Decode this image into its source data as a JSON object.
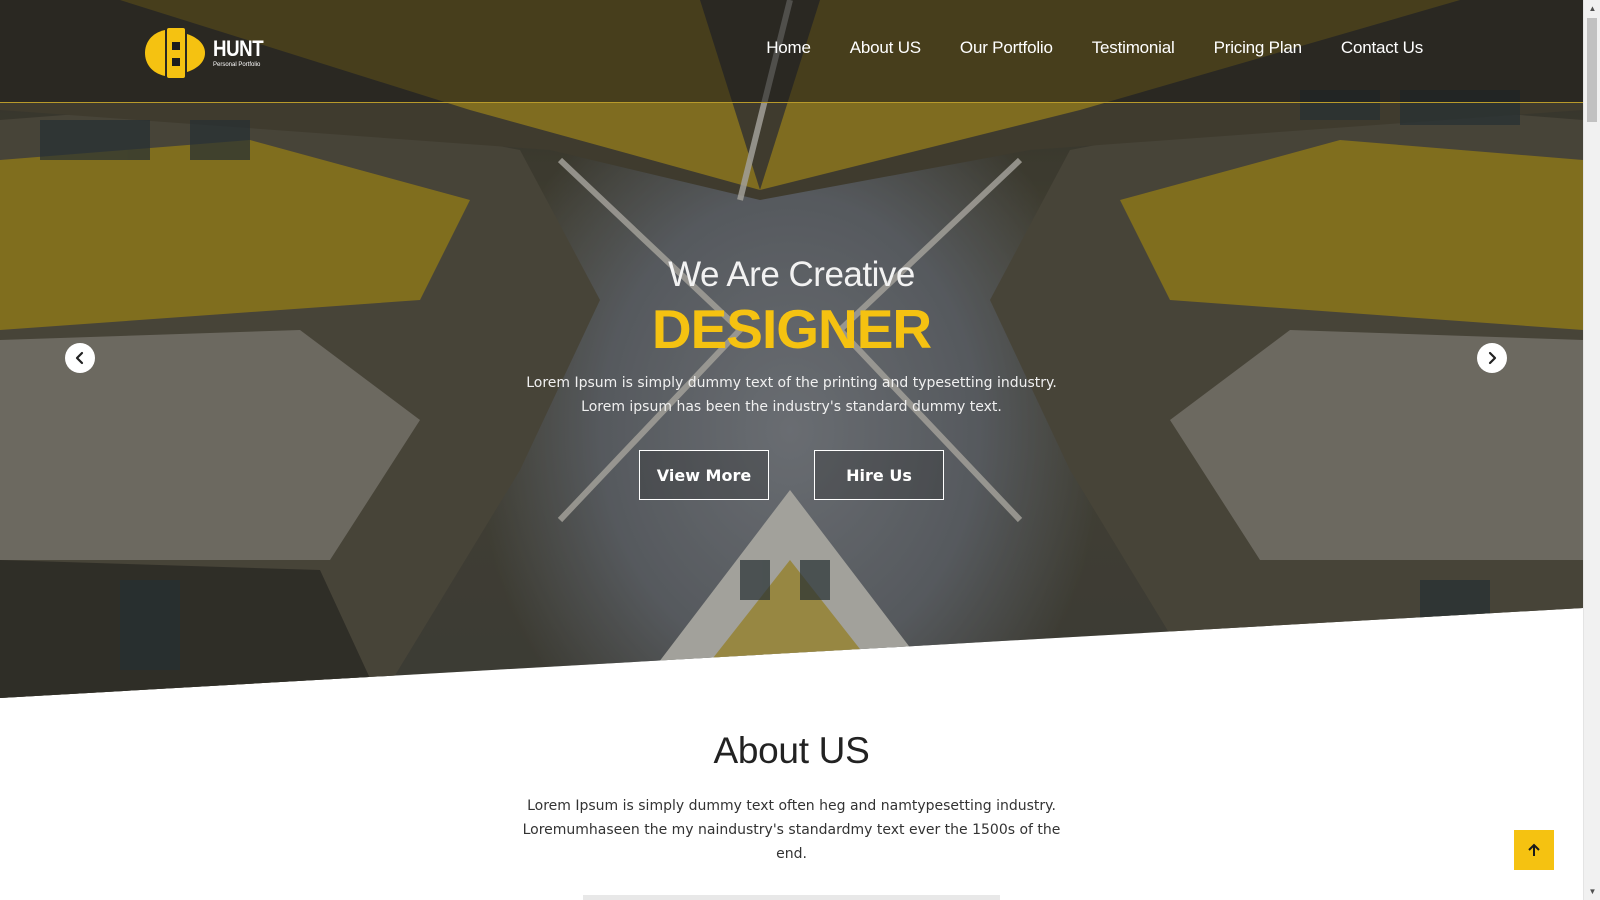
{
  "brand": {
    "title": "HUNT",
    "subtitle": "Personal Portfolio",
    "accent": "#f5c211"
  },
  "nav": {
    "items": [
      "Home",
      "About US",
      "Our Portfolio",
      "Testimonial",
      "Pricing Plan",
      "Contact Us"
    ]
  },
  "hero": {
    "subtitle": "We Are Creative",
    "title": "DESIGNER",
    "description": "Lorem Ipsum is simply dummy text of the printing and typesetting industry. Lorem ipsum has been the industry's standard dummy text.",
    "view_more_label": "View More",
    "hire_us_label": "Hire Us",
    "prev_icon": "chevron-left-icon",
    "next_icon": "chevron-right-icon"
  },
  "about": {
    "title": "About US",
    "description_line1": "Lorem Ipsum is simply dummy text often heg and namtypesetting industry.",
    "description_line2": "Loremumhaseen the my naindustry's standardmy text ever the 1500s of the end."
  },
  "back_to_top": {
    "icon": "arrow-up-icon"
  }
}
